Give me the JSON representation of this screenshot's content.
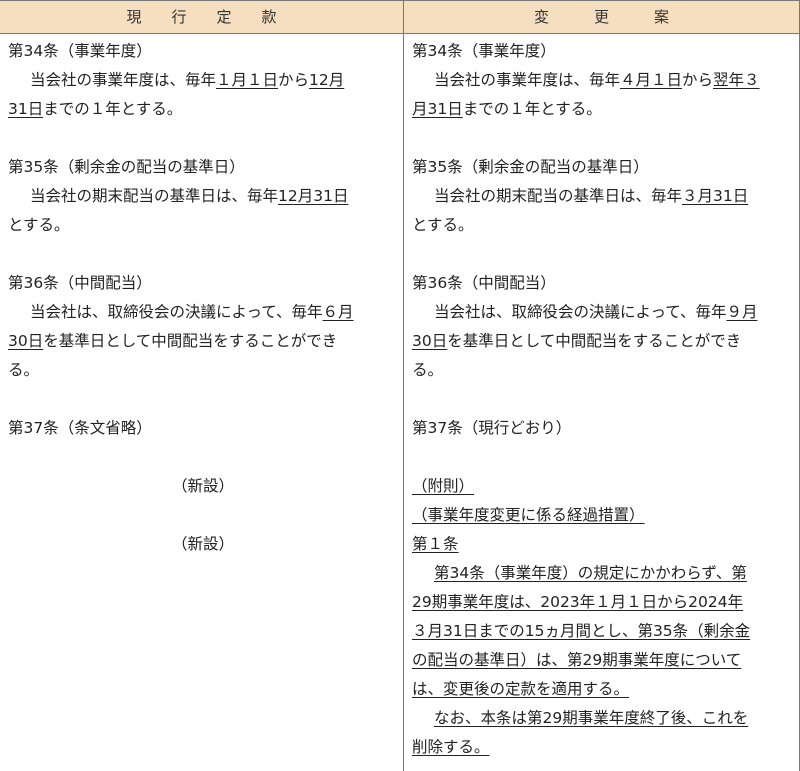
{
  "header": {
    "left": "現　　行　　定　　款",
    "right": "変　　　更　　　案"
  },
  "left": {
    "a34_title": "第34条（事業年度）",
    "a34_l1_pre": "当会社の事業年度は、毎年",
    "a34_l1_u1": "１月１日",
    "a34_l1_mid": "から",
    "a34_l1_u2": "12月",
    "a34_l2_u": "31日",
    "a34_l2_post": "までの１年とする。",
    "a35_title": "第35条（剰余金の配当の基準日）",
    "a35_l1_pre": "当会社の期末配当の基準日は、毎年",
    "a35_l1_u": "12月31日",
    "a35_l2": "とする。",
    "a36_title": "第36条（中間配当）",
    "a36_l1_pre": "当会社は、取締役会の決議によって、毎年",
    "a36_l1_u": "６月",
    "a36_l2_u": "30日",
    "a36_l2_post": "を基準日として中間配当をすることができ",
    "a36_l3": "る。",
    "a37_title": "第37条（条文省略）",
    "new1": "（新設）",
    "new2": "（新設）"
  },
  "right": {
    "a34_title": "第34条（事業年度）",
    "a34_l1_pre": "当会社の事業年度は、毎年",
    "a34_l1_u1": "４月１日",
    "a34_l1_mid": "から",
    "a34_l1_u2": "翌年３",
    "a34_l2_u": "月31日",
    "a34_l2_post": "までの１年とする。",
    "a35_title": "第35条（剰余金の配当の基準日）",
    "a35_l1_pre": "当会社の期末配当の基準日は、毎年",
    "a35_l1_u": "３月31日",
    "a35_l2": "とする。",
    "a36_title": "第36条（中間配当）",
    "a36_l1_pre": "当会社は、取締役会の決議によって、毎年",
    "a36_l1_u": "９月",
    "a36_l2_u": "30日",
    "a36_l2_post": "を基準日として中間配当をすることができ",
    "a36_l3": "る。",
    "a37_title": "第37条（現行どおり）",
    "supp_title": "（附則）",
    "supp_heading": "（事業年度変更に係る経過措置）",
    "supp_article": "第１条",
    "supp_p1": [
      "第34条（事業年度）の規定にかかわらず、第",
      "29期事業年度は、2023年１月１日から2024年",
      "３月31日までの15ヵ月間とし、第35条（剰余金",
      "の配当の基準日）は、第29期事業年度について",
      "は、変更後の定款を適用する。"
    ],
    "supp_p2": [
      "なお、本条は第29期事業年度終了後、これを",
      "削除する。"
    ]
  }
}
